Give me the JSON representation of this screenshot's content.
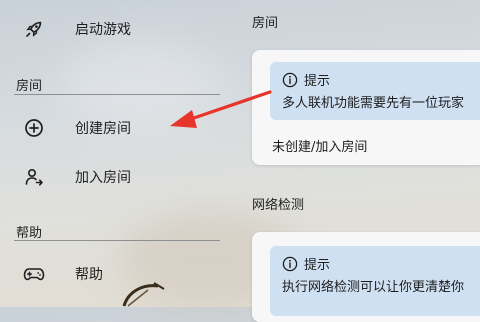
{
  "sidebar": {
    "start_game": {
      "label": "启动游戏",
      "icon": "rocket-icon"
    },
    "section_room": "房间",
    "create_room": {
      "label": "创建房间",
      "icon": "plus-circle-icon"
    },
    "join_room": {
      "label": "加入房间",
      "icon": "person-join-icon"
    },
    "section_help": "帮助",
    "help": {
      "label": "帮助",
      "icon": "gamepad-icon"
    }
  },
  "main": {
    "room": {
      "title": "房间",
      "tip_title": "提示",
      "tip_message": "多人联机功能需要先有一位玩家",
      "status": "未创建/加入房间"
    },
    "network": {
      "title": "网络检测",
      "tip_title": "提示",
      "tip_message": "执行网络检测可以让你更清楚你"
    }
  },
  "annotation": {
    "color": "#e8352c",
    "icon": "red-arrow-annotation"
  }
}
